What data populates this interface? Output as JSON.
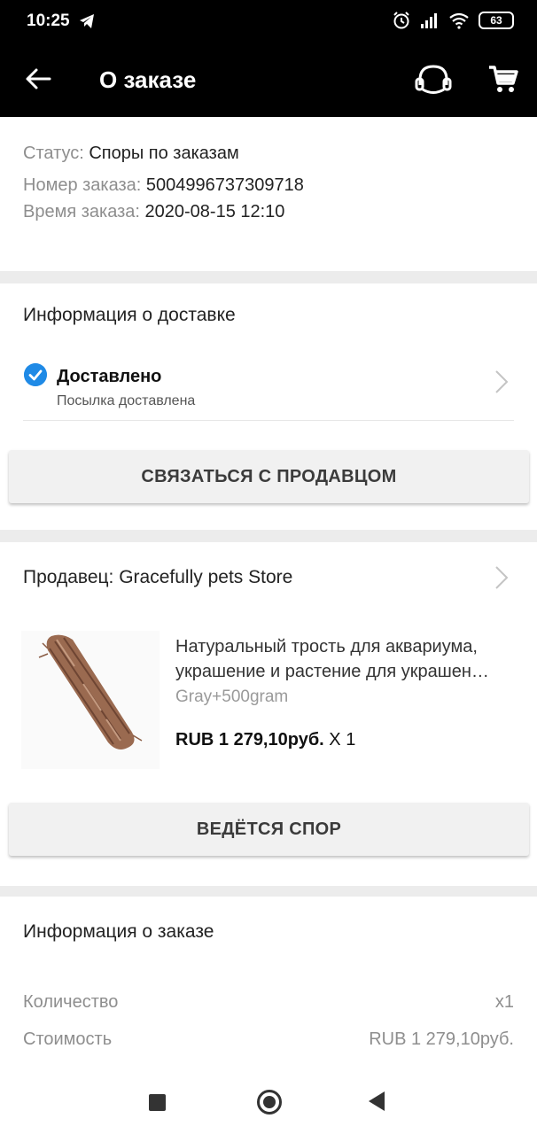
{
  "status_bar": {
    "time": "10:25",
    "battery": "63"
  },
  "app_bar": {
    "title": "О заказе"
  },
  "order_summary": {
    "status_label": "Статус:",
    "status_value": "Споры по заказам",
    "number_label": "Номер заказа:",
    "number_value": "5004996737309718",
    "time_label": "Время заказа:",
    "time_value": "2020-08-15 12:10"
  },
  "delivery": {
    "section_title": "Информация о доставке",
    "status_title": "Доставлено",
    "status_subtitle": "Посылка доставлена",
    "contact_button": "СВЯЗАТЬСЯ С ПРОДАВЦОМ"
  },
  "seller": {
    "label": "Продавец: Gracefully pets Store",
    "product": {
      "name_line1": "Натуральный трость для аквариума,",
      "name_line2": "украшение и растение для украшен…",
      "variant": "Gray+500gram",
      "price": "RUB 1 279,10руб.",
      "quantity": " X 1"
    },
    "dispute_button": "ВЕДЁТСЯ СПОР"
  },
  "order_info": {
    "section_title": "Информация о заказе",
    "rows": [
      {
        "label": "Количество",
        "value": "x1"
      },
      {
        "label": "Стоимость",
        "value": "RUB 1 279,10руб."
      }
    ]
  },
  "colors": {
    "accent": "#1f8ae6",
    "app_bar": "#000000"
  }
}
